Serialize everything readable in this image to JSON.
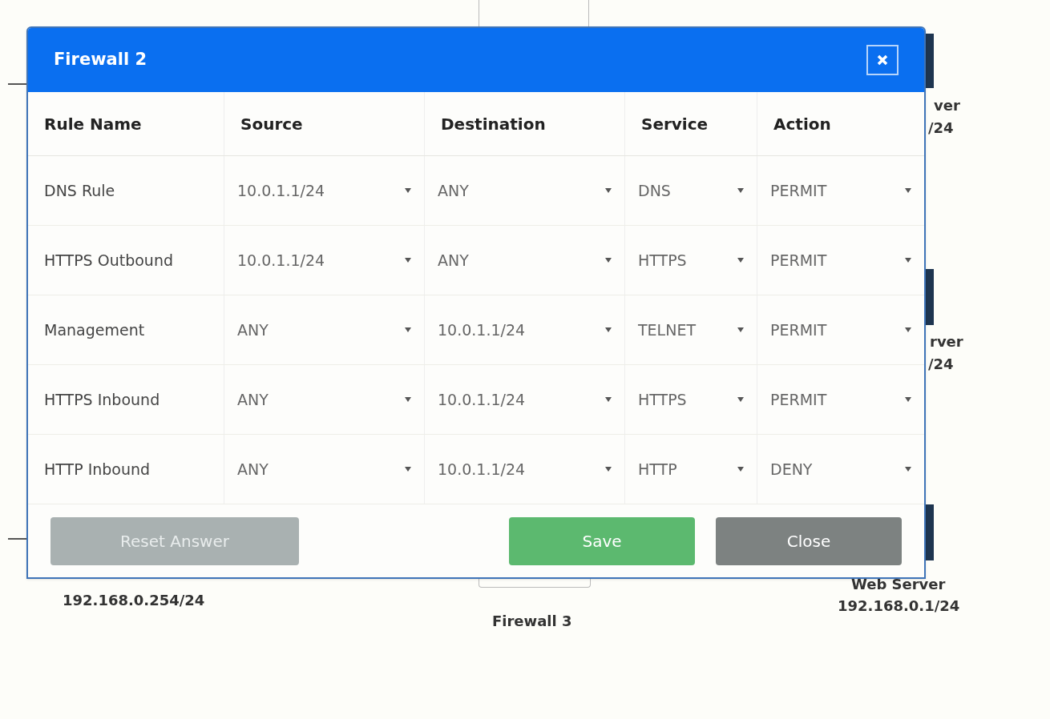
{
  "diagram": {
    "labels": [
      "ver",
      "/24",
      "rver",
      "/24",
      "192.168.0.254/24",
      "Firewall 3",
      "Web Server",
      "192.168.0.1/24"
    ]
  },
  "dialog": {
    "title": "Firewall 2",
    "table": {
      "columns": [
        "Rule Name",
        "Source",
        "Destination",
        "Service",
        "Action"
      ],
      "rows": [
        {
          "rule_name": "DNS Rule",
          "source": "10.0.1.1/24",
          "destination": "ANY",
          "service": "DNS",
          "action": "PERMIT"
        },
        {
          "rule_name": "HTTPS Outbound",
          "source": "10.0.1.1/24",
          "destination": "ANY",
          "service": "HTTPS",
          "action": "PERMIT"
        },
        {
          "rule_name": "Management",
          "source": "ANY",
          "destination": "10.0.1.1/24",
          "service": "TELNET",
          "action": "PERMIT"
        },
        {
          "rule_name": "HTTPS Inbound",
          "source": "ANY",
          "destination": "10.0.1.1/24",
          "service": "HTTPS",
          "action": "PERMIT"
        },
        {
          "rule_name": "HTTP Inbound",
          "source": "ANY",
          "destination": "10.0.1.1/24",
          "service": "HTTP",
          "action": "DENY"
        }
      ]
    },
    "buttons": [
      {
        "kind": "reset",
        "label": "Reset Answer"
      },
      {
        "kind": "save",
        "label": "Save"
      },
      {
        "kind": "close",
        "label": "Close"
      }
    ]
  }
}
